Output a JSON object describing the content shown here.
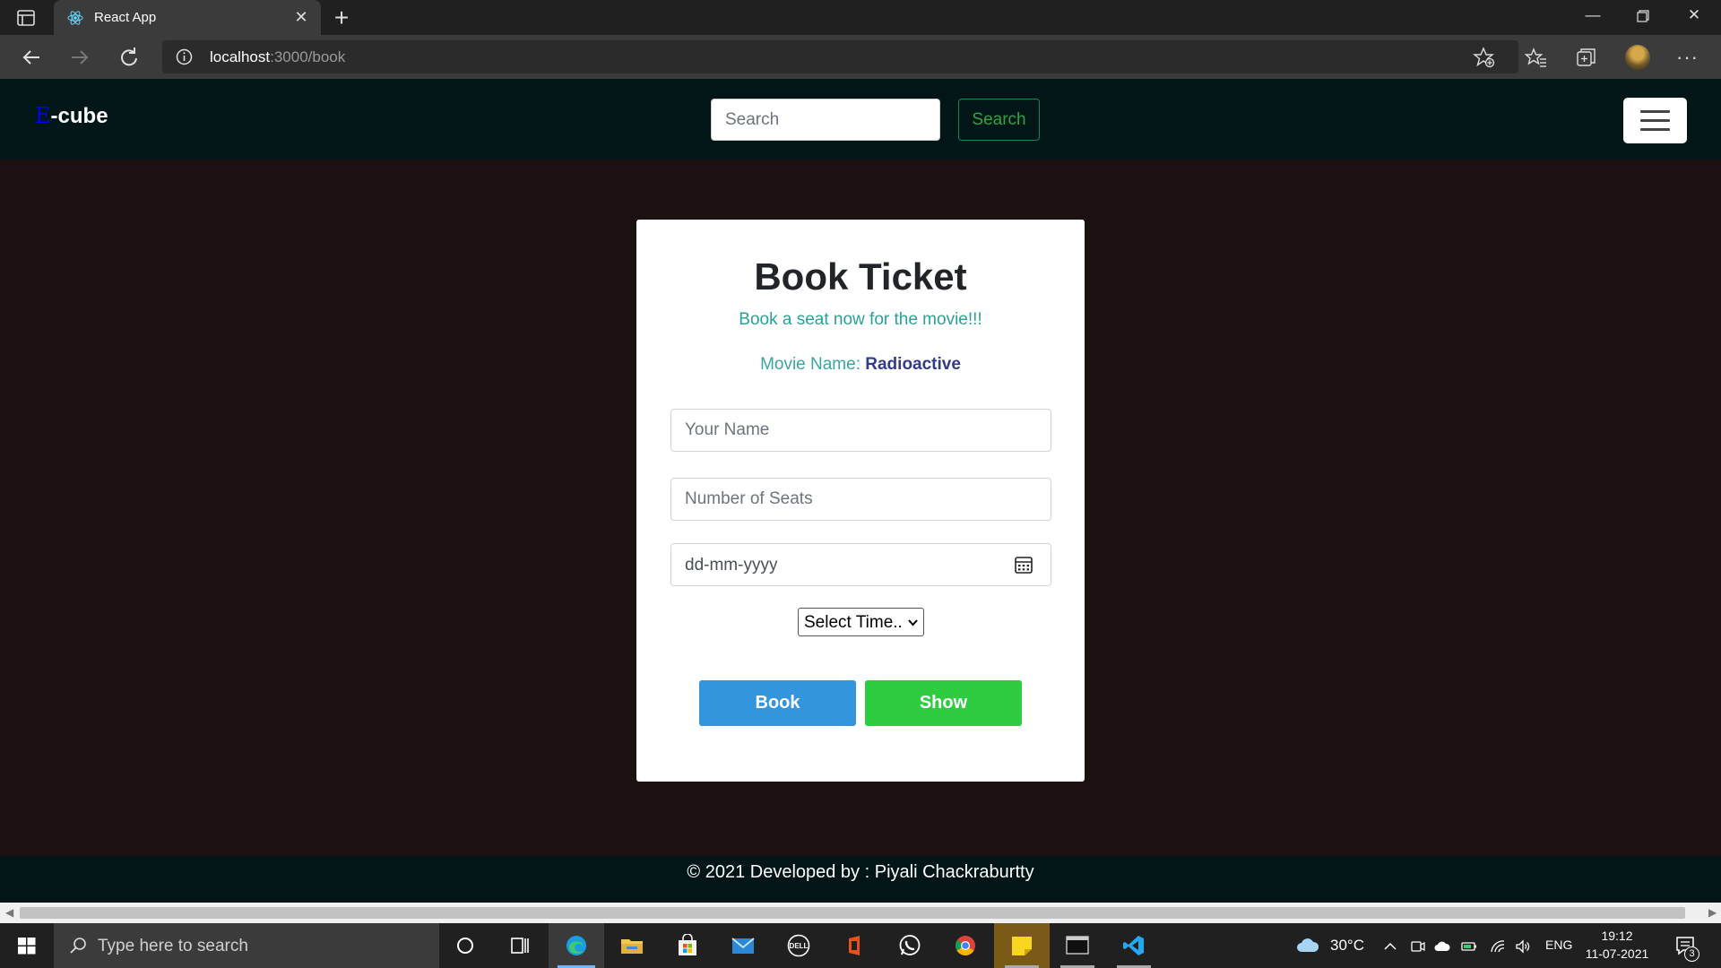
{
  "browser": {
    "tab_title": "React App",
    "url_host": "localhost",
    "url_path": ":3000/book",
    "icons": [
      "sidebar-icon",
      "react-favicon-icon",
      "close-icon",
      "plus-icon",
      "back-icon",
      "forward-icon",
      "refresh-icon",
      "info-icon",
      "favorite-add-icon",
      "favorites-icon",
      "collections-icon",
      "profile-avatar",
      "more-icon",
      "minimize-icon",
      "restore-icon",
      "close-window-icon"
    ]
  },
  "navbar": {
    "brand_first": "E",
    "brand_rest": "-cube",
    "search_placeholder": "Search",
    "search_button": "Search"
  },
  "booking": {
    "title": "Book Ticket",
    "subtitle": "Book a seat now for the movie!!!",
    "movie_label": "Movie Name: ",
    "movie_name": "Radioactive",
    "name_placeholder": "Your Name",
    "seats_placeholder": "Number of Seats",
    "date_placeholder": "dd-mm-yyyy",
    "time_select": "Select Time..",
    "book_button": "Book",
    "show_button": "Show"
  },
  "footer": {
    "text": "© 2021 Developed by : Piyali Chackraburtty"
  },
  "taskbar": {
    "search_placeholder": "Type here to search",
    "weather": "30°C",
    "language": "ENG",
    "time": "19:12",
    "date": "11-07-2021",
    "notification_count": "3"
  },
  "colors": {
    "page_bg": "#1c1111",
    "navbar_bg": "#021618",
    "book_button": "#3396dd",
    "show_button": "#2ecc40",
    "subtitle": "#2aa198",
    "movie_name": "#333a8a"
  }
}
